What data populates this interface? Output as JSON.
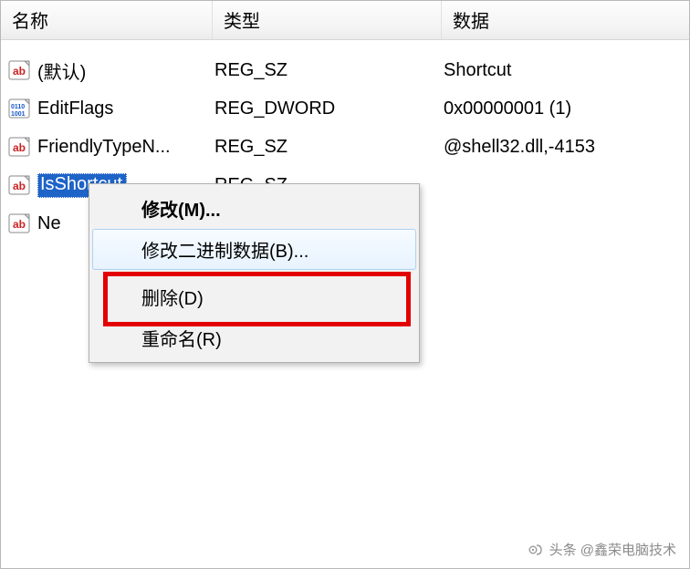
{
  "columns": {
    "name": "名称",
    "type": "类型",
    "data": "数据"
  },
  "rows": [
    {
      "icon": "string",
      "name": "(默认)",
      "type": "REG_SZ",
      "data": "Shortcut"
    },
    {
      "icon": "binary",
      "name": "EditFlags",
      "type": "REG_DWORD",
      "data": "0x00000001 (1)"
    },
    {
      "icon": "string",
      "name": "FriendlyTypeN...",
      "type": "REG_SZ",
      "data": "@shell32.dll,-4153"
    },
    {
      "icon": "string",
      "name": "IsShortcut",
      "type": "REG_SZ",
      "data": "",
      "selected": true
    },
    {
      "icon": "string",
      "name": "Ne",
      "type": "",
      "data": ""
    }
  ],
  "context_menu": {
    "modify": "修改(M)...",
    "modify_binary": "修改二进制数据(B)...",
    "delete": "删除(D)",
    "rename": "重命名(R)"
  },
  "watermark": "头条 @鑫荣电脑技术"
}
